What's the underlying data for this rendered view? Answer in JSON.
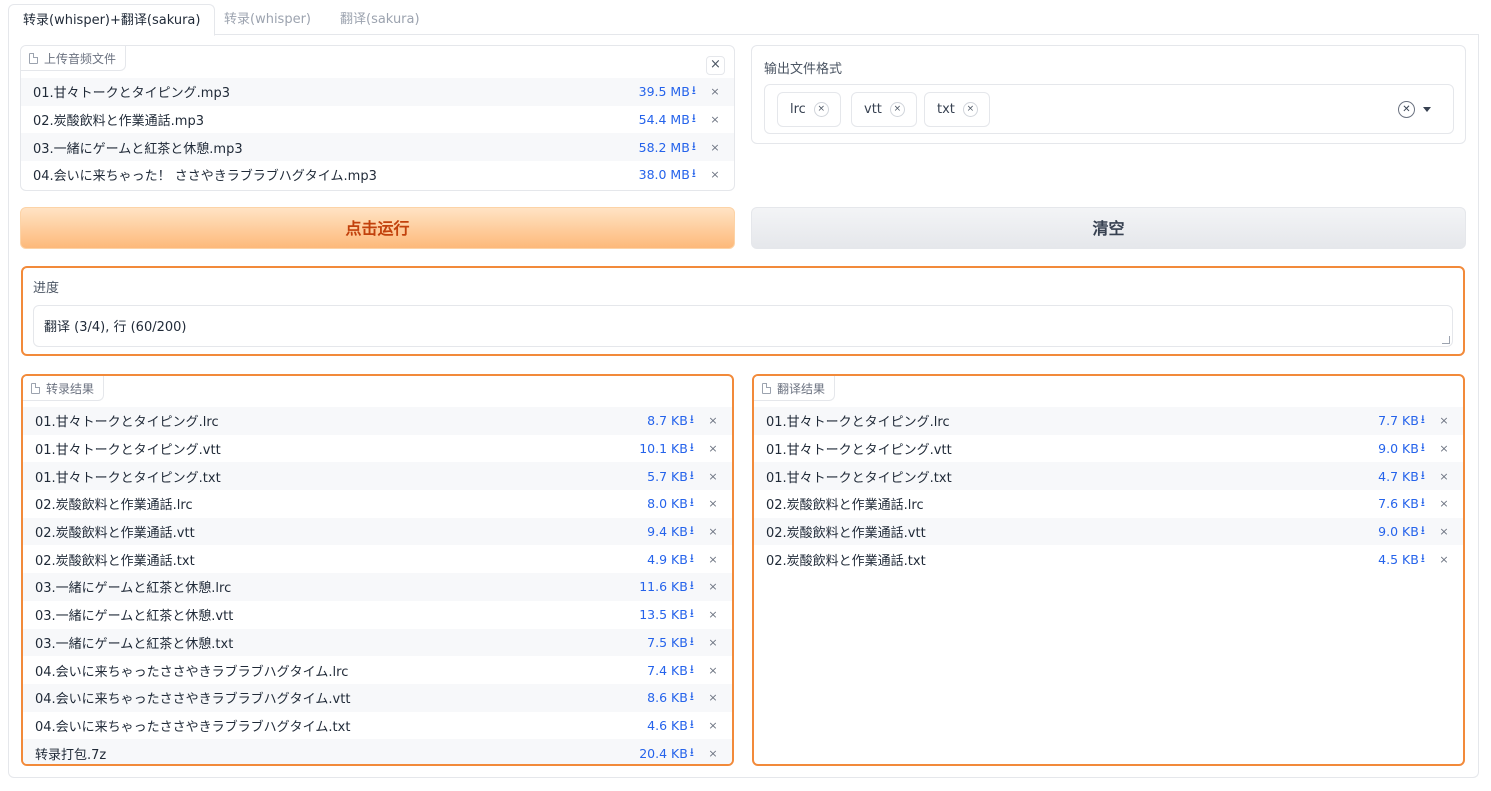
{
  "tabs": [
    {
      "label": "转录(whisper)+翻译(sakura)"
    },
    {
      "label": "转录(whisper)"
    },
    {
      "label": "翻译(sakura)"
    }
  ],
  "upload": {
    "label": "上传音频文件",
    "close": "×",
    "files": [
      {
        "name": "01.甘々トークとタイピング.mp3",
        "size": "39.5 MB"
      },
      {
        "name": "02.炭酸飲料と作業通話.mp3",
        "size": "54.4 MB"
      },
      {
        "name": "03.一緒にゲームと紅茶と休憩.mp3",
        "size": "58.2 MB"
      },
      {
        "name": "04.会いに来ちゃった！ ささやきラブラブハグタイム.mp3",
        "size": "38.0 MB"
      }
    ]
  },
  "format": {
    "label": "输出文件格式",
    "selected": [
      "lrc",
      "vtt",
      "txt"
    ],
    "clear": "✕"
  },
  "buttons": {
    "run": "点击运行",
    "clear": "清空"
  },
  "progress": {
    "label": "进度",
    "value": "翻译 (3/4), 行 (60/200)"
  },
  "transcribe": {
    "label": "转录结果",
    "files": [
      {
        "name": "01.甘々トークとタイピング.lrc",
        "size": "8.7 KB"
      },
      {
        "name": "01.甘々トークとタイピング.vtt",
        "size": "10.1 KB"
      },
      {
        "name": "01.甘々トークとタイピング.txt",
        "size": "5.7 KB"
      },
      {
        "name": "02.炭酸飲料と作業通話.lrc",
        "size": "8.0 KB"
      },
      {
        "name": "02.炭酸飲料と作業通話.vtt",
        "size": "9.4 KB"
      },
      {
        "name": "02.炭酸飲料と作業通話.txt",
        "size": "4.9 KB"
      },
      {
        "name": "03.一緒にゲームと紅茶と休憩.lrc",
        "size": "11.6 KB"
      },
      {
        "name": "03.一緒にゲームと紅茶と休憩.vtt",
        "size": "13.5 KB"
      },
      {
        "name": "03.一緒にゲームと紅茶と休憩.txt",
        "size": "7.5 KB"
      },
      {
        "name": "04.会いに来ちゃったささやきラブラブハグタイム.lrc",
        "size": "7.4 KB"
      },
      {
        "name": "04.会いに来ちゃったささやきラブラブハグタイム.vtt",
        "size": "8.6 KB"
      },
      {
        "name": "04.会いに来ちゃったささやきラブラブハグタイム.txt",
        "size": "4.6 KB"
      },
      {
        "name": "转录打包.7z",
        "size": "20.4 KB"
      }
    ]
  },
  "translate": {
    "label": "翻译结果",
    "files": [
      {
        "name": "01.甘々トークとタイピング.lrc",
        "size": "7.7 KB"
      },
      {
        "name": "01.甘々トークとタイピング.vtt",
        "size": "9.0 KB"
      },
      {
        "name": "01.甘々トークとタイピング.txt",
        "size": "4.7 KB"
      },
      {
        "name": "02.炭酸飲料と作業通話.lrc",
        "size": "7.6 KB"
      },
      {
        "name": "02.炭酸飲料と作業通話.vtt",
        "size": "9.0 KB"
      },
      {
        "name": "02.炭酸飲料と作業通話.txt",
        "size": "4.5 KB"
      }
    ]
  },
  "icons": {
    "download": "⭳",
    "remove": "×"
  },
  "colors": {
    "accent": "#f28a3a",
    "link": "#2563eb",
    "run_text": "#c2410c"
  }
}
